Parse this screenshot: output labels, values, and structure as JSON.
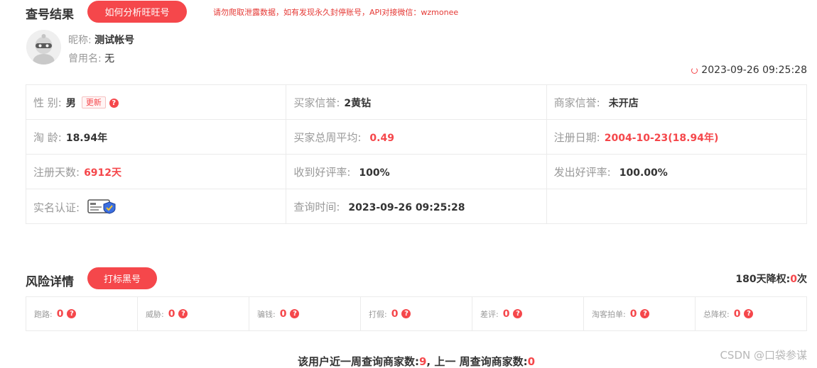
{
  "header": {
    "title": "查号结果",
    "analyze_button": "如何分析旺旺号",
    "notice": "请勿爬取泄露数据，如有发现永久封停账号，API对接微信：wzmonee"
  },
  "profile": {
    "nickname_label": "昵称:",
    "nickname_value": "测试帐号",
    "former_label": "曾用名:",
    "former_value": "无"
  },
  "query_timestamp": "2023-09-26 09:25:28",
  "info": {
    "gender_label": "性 别:",
    "gender_value": "男",
    "gender_update": "更新",
    "buyer_credit_label": "买家信誉:",
    "buyer_credit_value": "2黄钻",
    "seller_credit_label": "商家信誉:",
    "seller_credit_value": "未开店",
    "age_label": "淘 龄:",
    "age_value": "18.94年",
    "weekly_avg_label": "买家总周平均:",
    "weekly_avg_value": "0.49",
    "reg_date_label": "注册日期:",
    "reg_date_value": "2004-10-23(18.94年)",
    "reg_days_label": "注册天数:",
    "reg_days_value": "6912天",
    "good_recv_label": "收到好评率:",
    "good_recv_value": "100%",
    "good_sent_label": "发出好评率:",
    "good_sent_value": "100.00%",
    "realname_label": "实名认证:",
    "query_time_label": "查询时间:",
    "query_time_value": "2023-09-26 09:25:28"
  },
  "risk": {
    "title": "风险详情",
    "mark_button": "打标黑号",
    "deduct_prefix": "180天降权:",
    "deduct_value": "0",
    "deduct_suffix": "次",
    "items": [
      {
        "label": "跑路:",
        "value": "0"
      },
      {
        "label": "威胁:",
        "value": "0"
      },
      {
        "label": "骗钱:",
        "value": "0"
      },
      {
        "label": "打假:",
        "value": "0"
      },
      {
        "label": "差评:",
        "value": "0"
      },
      {
        "label": "淘客拍单:",
        "value": "0"
      },
      {
        "label": "总降权:",
        "value": "0"
      }
    ]
  },
  "bottom": {
    "prefix": "该用户近一周查询商家数:",
    "week_value": "9",
    "mid": ", 上一 周查询商家数:",
    "prev_value": "0"
  },
  "watermark": "CSDN @口袋参谋",
  "colors": {
    "accent": "#f5474b",
    "border": "#ebebeb",
    "label": "#999999"
  }
}
